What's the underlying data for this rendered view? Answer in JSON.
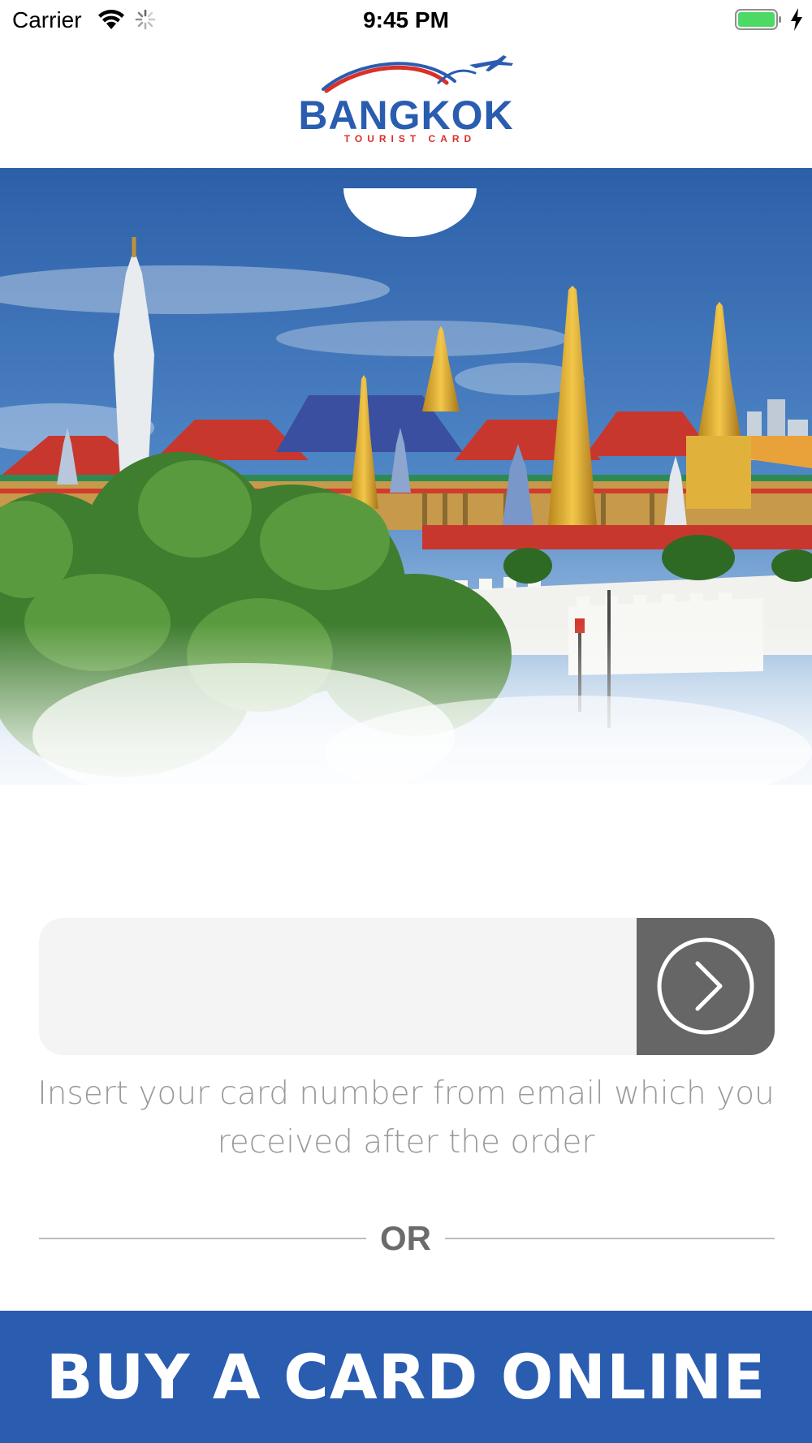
{
  "status_bar": {
    "carrier": "Carrier",
    "time": "9:45 PM",
    "battery_color": "#4cd964"
  },
  "header": {
    "logo_word": "BANGKOK",
    "logo_sub": "TOURIST CARD",
    "brand_blue": "#2a5cb0",
    "brand_red": "#d9302a"
  },
  "hero": {
    "icon": "grand-palace-photo"
  },
  "card_entry": {
    "value": "",
    "placeholder": "",
    "submit_icon": "chevron-right-circle-icon",
    "hint_line1": "Insert your card number from email which you",
    "hint_line2": "received after the order"
  },
  "divider": {
    "label": "OR"
  },
  "buy_button": {
    "label": "BUY A CARD ONLINE",
    "color": "#2a5cb0"
  }
}
